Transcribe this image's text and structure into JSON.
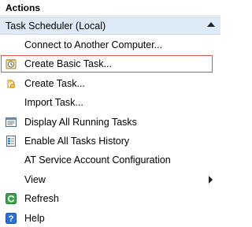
{
  "header": {
    "title": "Actions"
  },
  "group": {
    "title": "Task Scheduler (Local)"
  },
  "items": [
    {
      "label": "Connect to Another Computer..."
    },
    {
      "label": "Create Basic Task..."
    },
    {
      "label": "Create Task..."
    },
    {
      "label": "Import Task..."
    },
    {
      "label": "Display All Running Tasks"
    },
    {
      "label": "Enable All Tasks History"
    },
    {
      "label": "AT Service Account Configuration"
    },
    {
      "label": "View"
    },
    {
      "label": "Refresh"
    },
    {
      "label": "Help"
    }
  ],
  "icons": {
    "create_basic_task": "wizard-clock-icon",
    "create_task": "task-icon",
    "display_running": "running-tasks-icon",
    "enable_history": "history-icon",
    "view_submenu": "submenu-arrow-icon",
    "refresh": "refresh-icon",
    "help": "help-icon"
  },
  "colors": {
    "group_header_bg": "#dcebf7",
    "highlight_border": "#d9534f"
  }
}
